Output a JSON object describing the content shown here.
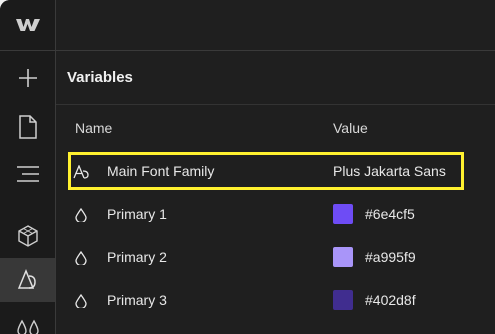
{
  "app": {
    "logo_icon": "webflow-logo-icon"
  },
  "rail": {
    "items": [
      {
        "icon": "add-icon"
      },
      {
        "icon": "page-icon"
      },
      {
        "icon": "navigator-icon"
      },
      {
        "icon": "components-cube-icon"
      },
      {
        "icon": "variables-icon",
        "active": true
      },
      {
        "icon": "drops-icon"
      }
    ]
  },
  "panel": {
    "title": "Variables",
    "columns": {
      "name": "Name",
      "value": "Value"
    },
    "rows": [
      {
        "icon": "font-icon",
        "name": "Main Font Family",
        "value": "Plus Jakarta Sans",
        "highlighted": true
      },
      {
        "icon": "color-drop-icon",
        "name": "Primary 1",
        "value": "#6e4cf5",
        "swatch": "#6e4cf5"
      },
      {
        "icon": "color-drop-icon",
        "name": "Primary 2",
        "value": "#a995f9",
        "swatch": "#a995f9"
      },
      {
        "icon": "color-drop-icon",
        "name": "Primary 3",
        "value": "#402d8f",
        "swatch": "#402d8f"
      }
    ]
  },
  "colors": {
    "highlight": "#fff12f",
    "background": "#1f1f1f"
  }
}
